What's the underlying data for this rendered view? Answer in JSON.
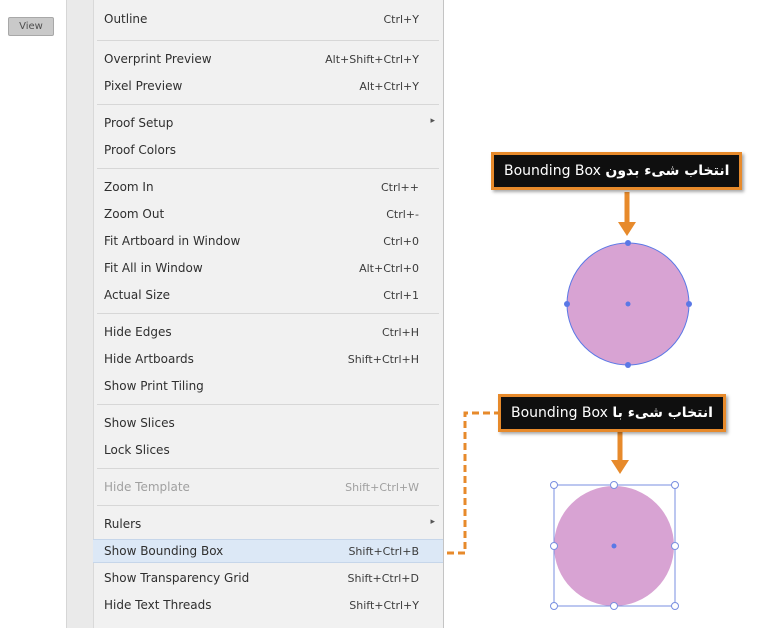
{
  "view_button": {
    "label": "View"
  },
  "menu": {
    "items": [
      {
        "label": "Outline",
        "shortcut": "Ctrl+Y"
      },
      {
        "label": "Overprint Preview",
        "shortcut": "Alt+Shift+Ctrl+Y"
      },
      {
        "label": "Pixel Preview",
        "shortcut": "Alt+Ctrl+Y"
      },
      {
        "label": "Proof Setup",
        "shortcut": "",
        "submenu_arrow": "▸"
      },
      {
        "label": "Proof Colors",
        "shortcut": ""
      },
      {
        "label": "Zoom In",
        "shortcut": "Ctrl++"
      },
      {
        "label": "Zoom Out",
        "shortcut": "Ctrl+-"
      },
      {
        "label": "Fit Artboard in Window",
        "shortcut": "Ctrl+0"
      },
      {
        "label": "Fit All in Window",
        "shortcut": "Alt+Ctrl+0"
      },
      {
        "label": "Actual Size",
        "shortcut": "Ctrl+1"
      },
      {
        "label": "Hide Edges",
        "shortcut": "Ctrl+H"
      },
      {
        "label": "Hide Artboards",
        "shortcut": "Shift+Ctrl+H"
      },
      {
        "label": "Show Print Tiling",
        "shortcut": ""
      },
      {
        "label": "Show Slices",
        "shortcut": ""
      },
      {
        "label": "Lock Slices",
        "shortcut": ""
      },
      {
        "label": "Hide Template",
        "shortcut": "Shift+Ctrl+W",
        "disabled": true
      },
      {
        "label": "Rulers",
        "shortcut": "",
        "submenu_arrow": "▸"
      },
      {
        "label": "Show Bounding Box",
        "shortcut": "Shift+Ctrl+B",
        "highlighted": true
      },
      {
        "label": "Show Transparency Grid",
        "shortcut": "Shift+Ctrl+D"
      },
      {
        "label": "Hide Text Threads",
        "shortcut": "Shift+Ctrl+Y"
      }
    ]
  },
  "callouts": {
    "top": {
      "fa": "انتخاب شیء بدون",
      "en": "Bounding Box"
    },
    "bottom": {
      "fa": "انتخاب شیء با",
      "en": "Bounding Box"
    }
  },
  "colors": {
    "accent_orange": "#e78a2b",
    "circle_fill": "#d8a3d3",
    "selection_blue": "#5a78e6",
    "menu_highlight": "#dce8f6"
  }
}
